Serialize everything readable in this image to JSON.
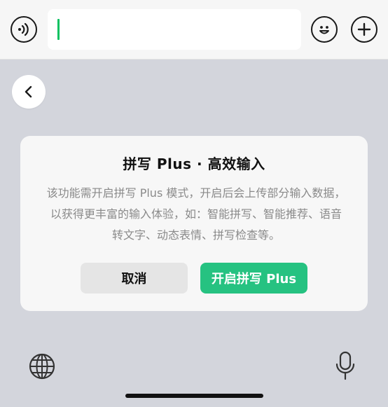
{
  "input_bar": {
    "voice_icon": "voice-input-icon",
    "emoji_icon": "emoji-icon",
    "plus_icon": "plus-icon",
    "input_value": ""
  },
  "keyboard": {
    "back_icon": "chevron-left-icon",
    "globe_icon": "globe-icon",
    "mic_icon": "microphone-icon"
  },
  "dialog": {
    "title": "拼写 Plus · 高效输入",
    "body": "该功能需开启拼写 Plus 模式，开启后会上传部分输入数据，以获得更丰富的输入体验，如：智能拼写、智能推荐、语音转文字、动态表情、拼写检查等。",
    "cancel_label": "取消",
    "confirm_label": "开启拼写 Plus"
  },
  "colors": {
    "accent": "#26c281",
    "caret": "#07c160"
  }
}
